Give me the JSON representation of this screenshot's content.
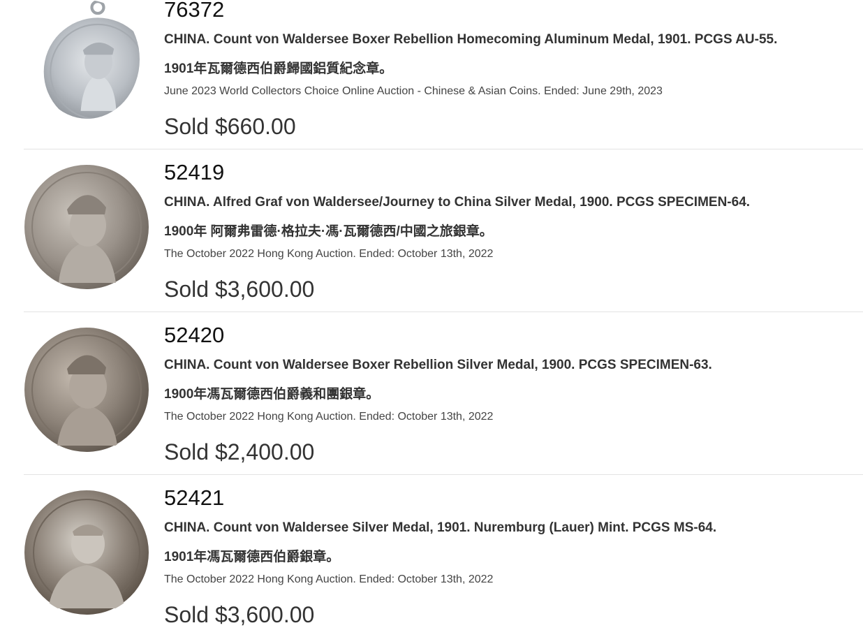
{
  "lots": [
    {
      "number": "76372",
      "title": "CHINA. Count von Waldersee Boxer Rebellion Homecoming Aluminum Medal, 1901. PCGS AU-55.",
      "title_cn": "1901年瓦爾德西伯爵歸國鋁質紀念章。",
      "auction": "June 2023 World Collectors Choice Online Auction - Chinese & Asian Coins. Ended: June 29th, 2023",
      "price": "Sold $660.00",
      "coin_color": "#b8bcc2"
    },
    {
      "number": "52419",
      "title": "CHINA. Alfred Graf von Waldersee/Journey to China Silver Medal, 1900. PCGS SPECIMEN-64.",
      "title_cn": "1900年 阿爾弗雷德·格拉夫·馮·瓦爾德西/中國之旅銀章。",
      "auction": "The October 2022 Hong Kong Auction. Ended: October 13th, 2022",
      "price": "Sold $3,600.00",
      "coin_color": "#9a928a"
    },
    {
      "number": "52420",
      "title": "CHINA. Count von Waldersee Boxer Rebellion Silver Medal, 1900. PCGS SPECIMEN-63.",
      "title_cn": "1900年馮瓦爾德西伯爵義和團銀章。",
      "auction": "The October 2022 Hong Kong Auction. Ended: October 13th, 2022",
      "price": "Sold $2,400.00",
      "coin_color": "#8c8278"
    },
    {
      "number": "52421",
      "title": "CHINA. Count von Waldersee Silver Medal, 1901. Nuremburg (Lauer) Mint. PCGS MS-64.",
      "title_cn": "1901年馮瓦爾德西伯爵銀章。",
      "auction": "The October 2022 Hong Kong Auction. Ended: October 13th, 2022",
      "price": "Sold $3,600.00",
      "coin_color": "#7e7468"
    }
  ]
}
